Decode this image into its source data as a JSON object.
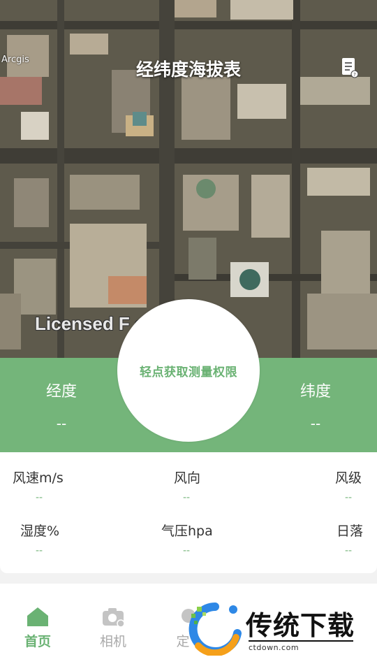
{
  "header": {
    "title": "经纬度海拔表",
    "map_credit": "Arcgis",
    "watermark": "Licensed F     er Use Only",
    "doc_icon": "document-help-icon"
  },
  "coordinates": {
    "longitude_label": "经度",
    "longitude_value": "--",
    "latitude_label": "纬度",
    "latitude_value": "--",
    "measure_button": "轻点获取测量权限"
  },
  "weather": {
    "wind_speed_label": "风速m/s",
    "wind_speed_value": "--",
    "wind_dir_label": "风向",
    "wind_dir_value": "--",
    "wind_level_label": "风级",
    "wind_level_value": "--",
    "humidity_label": "湿度%",
    "humidity_value": "--",
    "pressure_label": "气压hpa",
    "pressure_value": "--",
    "sunset_label": "日落",
    "sunset_value": "--"
  },
  "nav": {
    "items": [
      {
        "label": "首页",
        "icon": "home-icon",
        "active": true
      },
      {
        "label": "相机",
        "icon": "camera-icon",
        "active": false
      },
      {
        "label": "定",
        "icon": "location-icon",
        "active": false
      }
    ]
  },
  "overlay_logo": {
    "text": "传统下载",
    "sub": "ctdown.com"
  },
  "colors": {
    "accent": "#74b57a",
    "accent_text": "#6ab273"
  }
}
